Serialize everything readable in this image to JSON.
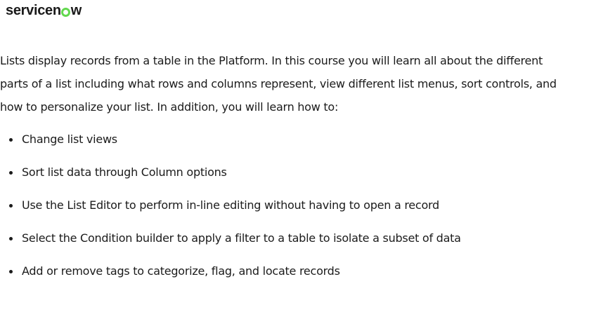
{
  "brand": {
    "before": "servicen",
    "after": "w",
    "accent_color": "#62d84e"
  },
  "intro": {
    "text": "Lists display records from a table in the Platform. In this course you will learn all about the different parts of a list including what rows and columns represent, view different list menus, sort controls, and how to personalize your list. In addition, you will learn how to:"
  },
  "objectives": [
    "Change list views",
    "Sort list data through Column options",
    "Use the List Editor to perform in-line editing without having to open a record",
    "Select the Condition builder to apply a filter to a table to isolate a subset of data",
    "Add or remove tags to categorize, flag, and locate records"
  ]
}
